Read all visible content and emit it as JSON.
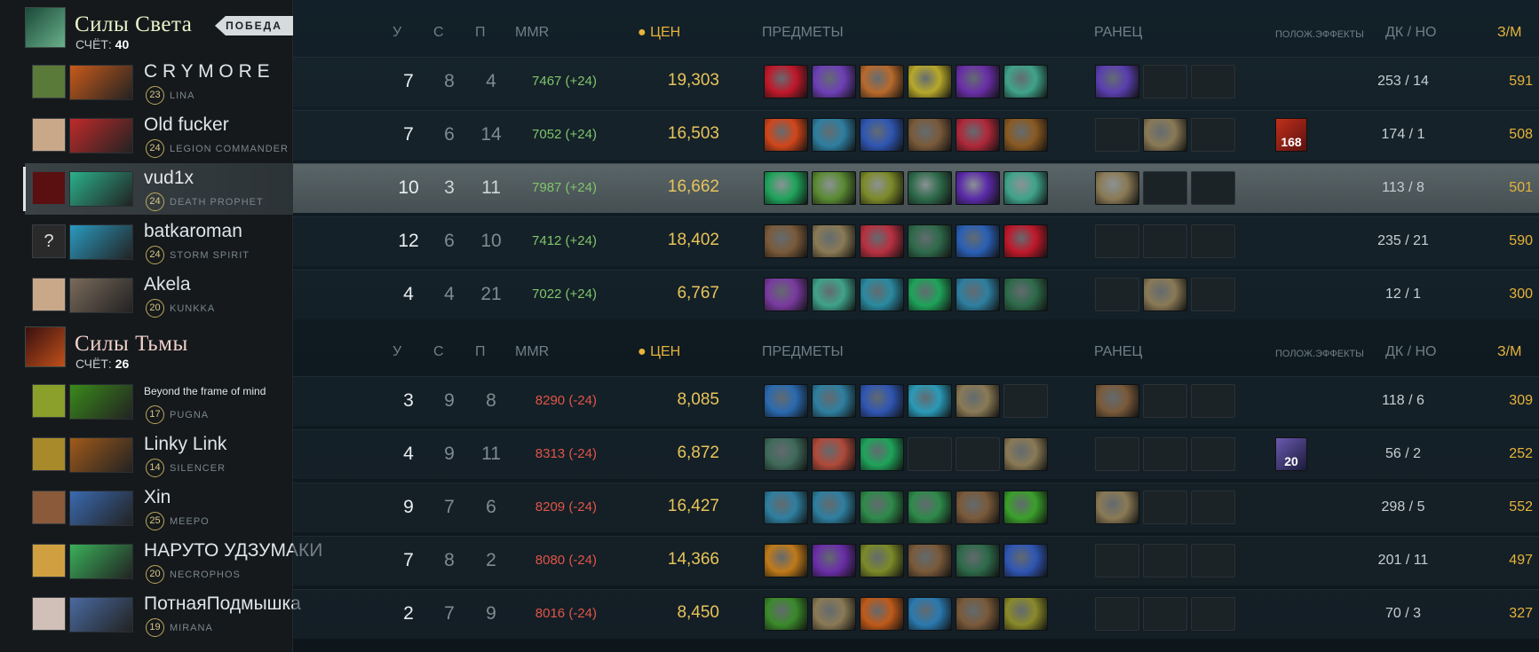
{
  "teams": [
    {
      "name": "Силы Света",
      "score_label": "СЧЁТ:",
      "score": "40",
      "badge": "ПОБЕДА",
      "color": "#eaf3c8"
    },
    {
      "name": "Силы Тьмы",
      "score_label": "СЧЁТ:",
      "score": "26",
      "badge": "",
      "color": "#f0d0c8"
    }
  ],
  "columns": {
    "k": "У",
    "d": "С",
    "a": "П",
    "mmr": "MMR",
    "networth": "ЦЕН",
    "items": "ПРЕДМЕТЫ",
    "backpack": "РАНЕЦ",
    "buffs": "ПОЛОЖ.ЭФФЕКТЫ",
    "lhdn": "ДК / НО",
    "gpm": "З/М"
  },
  "players": [
    {
      "name": "C R Y M O R E",
      "level": "23",
      "hero": "LINA",
      "k": "7",
      "d": "8",
      "a": "4",
      "mmr": "7467 (+24)",
      "nw": "19,303",
      "lh": "253",
      "dn": "14",
      "gpm": "591",
      "buff": "",
      "items": [
        "#c0182a",
        "#6d3fb6",
        "#b86a2c",
        "#b7a82a",
        "#6a2ea8",
        "#3fa38a"
      ],
      "bp": [
        "#5a3fb0",
        "",
        ""
      ]
    },
    {
      "name": "Old fucker",
      "level": "24",
      "hero": "LEGION COMMANDER",
      "k": "7",
      "d": "6",
      "a": "14",
      "mmr": "7052 (+24)",
      "nw": "16,503",
      "lh": "174",
      "dn": "1",
      "gpm": "508",
      "buff": "168",
      "items": [
        "#d2461a",
        "#2e7fa0",
        "#2f56b3",
        "#7a5a3a",
        "#b0283a",
        "#8a5a22"
      ],
      "bp": [
        "",
        "#8a7a55",
        ""
      ]
    },
    {
      "name": "vud1x",
      "level": "24",
      "hero": "DEATH PROPHET",
      "k": "10",
      "d": "3",
      "a": "11",
      "mmr": "7987 (+24)",
      "nw": "16,662",
      "lh": "113",
      "dn": "8",
      "gpm": "501",
      "buff": "",
      "items": [
        "#1fa35a",
        "#5a8a32",
        "#7c8a28",
        "#2e6a4a",
        "#5a2aa8",
        "#3fa38a"
      ],
      "bp": [
        "#8a7a55",
        "",
        ""
      ]
    },
    {
      "name": "batkaroman",
      "level": "24",
      "hero": "STORM SPIRIT",
      "k": "12",
      "d": "6",
      "a": "10",
      "mmr": "7412 (+24)",
      "nw": "18,402",
      "lh": "235",
      "dn": "21",
      "gpm": "590",
      "buff": "",
      "items": [
        "#7a5a3a",
        "#8a7a55",
        "#b83040",
        "#2e6a4a",
        "#2a5fb5",
        "#c0182a"
      ],
      "bp": [
        "",
        "",
        ""
      ]
    },
    {
      "name": "Akela",
      "level": "20",
      "hero": "KUNKKA",
      "k": "4",
      "d": "4",
      "a": "21",
      "mmr": "7022 (+24)",
      "nw": "6,767",
      "lh": "12",
      "dn": "1",
      "gpm": "300",
      "buff": "",
      "items": [
        "#7a3aa0",
        "#3fa38a",
        "#2a8aa0",
        "#1fa35a",
        "#2e7fa0",
        "#2e6a4a"
      ],
      "bp": [
        "",
        "#8a7a55",
        ""
      ]
    },
    {
      "name": "Beyond the frame of mind",
      "level": "17",
      "hero": "PUGNA",
      "k": "3",
      "d": "9",
      "a": "8",
      "mmr": "8290 (-24)",
      "nw": "8,085",
      "lh": "118",
      "dn": "6",
      "gpm": "309",
      "buff": "",
      "items": [
        "#2a6ab0",
        "#2e7fa0",
        "#2f56b3",
        "#2a9ab8",
        "#8a7a55",
        ""
      ],
      "bp": [
        "#7a5a3a",
        "",
        ""
      ]
    },
    {
      "name": "Linky Link",
      "level": "14",
      "hero": "SILENCER",
      "k": "4",
      "d": "9",
      "a": "11",
      "mmr": "8313 (-24)",
      "nw": "6,872",
      "lh": "56",
      "dn": "2",
      "gpm": "252",
      "buff": "20",
      "items": [
        "#3f6a5a",
        "#b04a3a",
        "#1fa35a",
        "",
        "",
        "#8a7a55"
      ],
      "bp": [
        "",
        "",
        ""
      ]
    },
    {
      "name": "Xin",
      "level": "25",
      "hero": "MEEPO",
      "k": "9",
      "d": "7",
      "a": "6",
      "mmr": "8209 (-24)",
      "nw": "16,427",
      "lh": "298",
      "dn": "5",
      "gpm": "552",
      "buff": "",
      "items": [
        "#2e7fa0",
        "#2e7fa0",
        "#2e8a4a",
        "#2e8a4a",
        "#7a5a3a",
        "#3aa02a"
      ],
      "bp": [
        "#8a7a55",
        "",
        ""
      ]
    },
    {
      "name": "НАРУТО УДЗУМАКИ",
      "level": "20",
      "hero": "NECROPHOS",
      "k": "7",
      "d": "8",
      "a": "2",
      "mmr": "8080 (-24)",
      "nw": "14,366",
      "lh": "201",
      "dn": "11",
      "gpm": "497",
      "buff": "",
      "items": [
        "#c07a1a",
        "#6a2ea8",
        "#7c8a28",
        "#7a5a3a",
        "#2e6a4a",
        "#2f56b3"
      ],
      "bp": [
        "",
        "",
        ""
      ]
    },
    {
      "name": "ПотнаяПодмышка",
      "level": "19",
      "hero": "MIRANA",
      "k": "2",
      "d": "7",
      "a": "9",
      "mmr": "8016 (-24)",
      "nw": "8,450",
      "lh": "70",
      "dn": "3",
      "gpm": "327",
      "buff": "",
      "items": [
        "#3a8a2a",
        "#8a7a55",
        "#c05a1a",
        "#2a7ab0",
        "#7a5a3a",
        "#8a8a2a"
      ],
      "bp": [
        "",
        "",
        ""
      ]
    }
  ]
}
